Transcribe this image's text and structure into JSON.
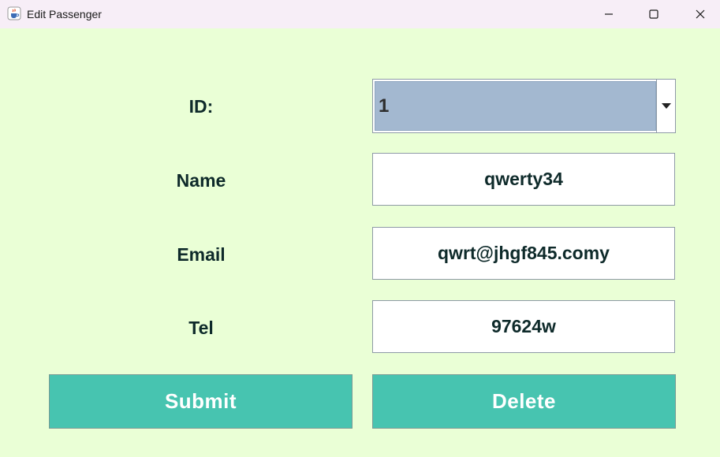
{
  "window": {
    "title": "Edit Passenger",
    "app_icon": "java-cup-icon",
    "controls": [
      "minimize-icon",
      "maximize-icon",
      "close-icon"
    ]
  },
  "form": {
    "id_label": "ID:",
    "id_value": "1",
    "name_label": "Name",
    "name_value": "qwerty34",
    "email_label": "Email",
    "email_value": "qwrt@jhgf845.comy",
    "tel_label": "Tel",
    "tel_value": "97624w"
  },
  "buttons": {
    "submit": "Submit",
    "delete": "Delete"
  },
  "colors": {
    "background": "#eaffd6",
    "titlebar": "#f7eef7",
    "button": "#47c4b0",
    "combo_selected": "#a3b8d0",
    "label_text": "#0e2a2a"
  }
}
